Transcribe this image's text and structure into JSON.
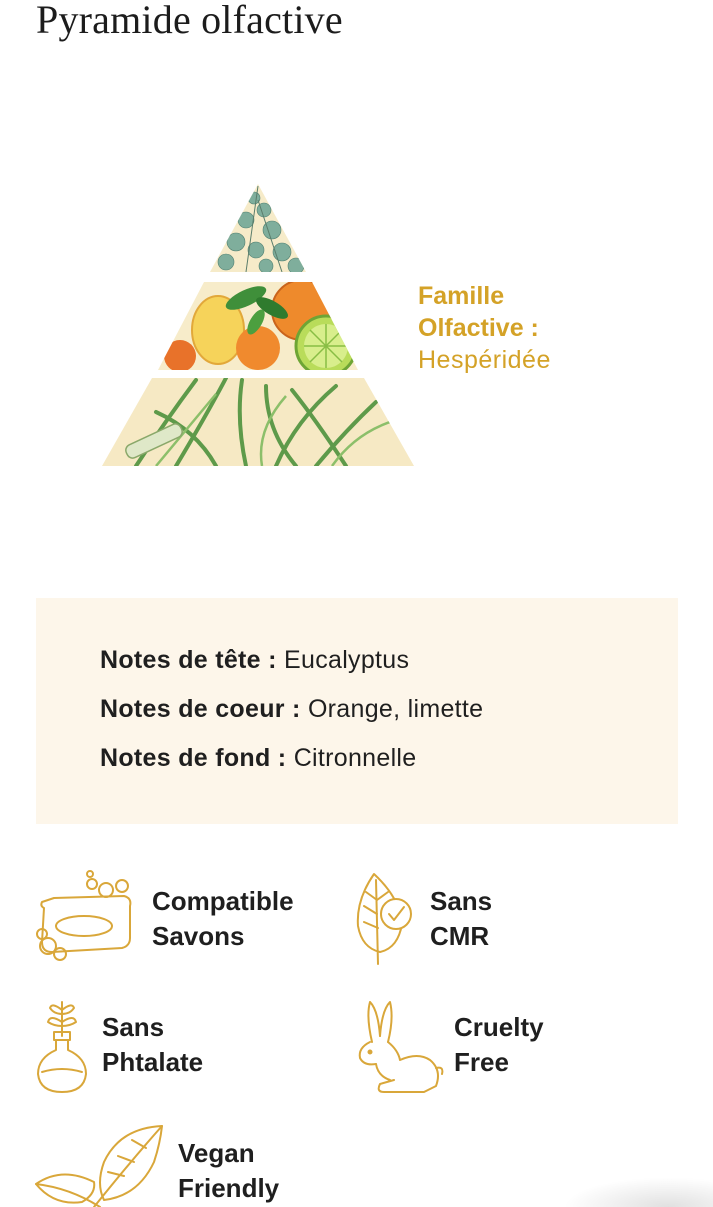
{
  "page": {
    "title": "Pyramide olfactive"
  },
  "family": {
    "label_line1": "Famille",
    "label_line2": "Olfactive :",
    "value": "Hespéridée"
  },
  "notes": [
    {
      "label": "Notes de tête :",
      "value": "Eucalyptus"
    },
    {
      "label": "Notes de coeur :",
      "value": "Orange, limette"
    },
    {
      "label": "Notes de fond :",
      "value": "Citronnelle"
    }
  ],
  "features": [
    {
      "line1": "Compatible",
      "line2": "Savons",
      "icon": "soap-icon"
    },
    {
      "line1": "Sans",
      "line2": "CMR",
      "icon": "leaf-check-icon"
    },
    {
      "line1": "Sans",
      "line2": "Phtalate",
      "icon": "plant-flask-icon"
    },
    {
      "line1": "Cruelty",
      "line2": "Free",
      "icon": "rabbit-icon"
    },
    {
      "line1": "Vegan",
      "line2": "Friendly",
      "icon": "leaves-icon"
    }
  ],
  "colors": {
    "accent_gold": "#d4a227",
    "panel_bg": "#fdf6ea",
    "icon_gold": "#d9a73a"
  }
}
